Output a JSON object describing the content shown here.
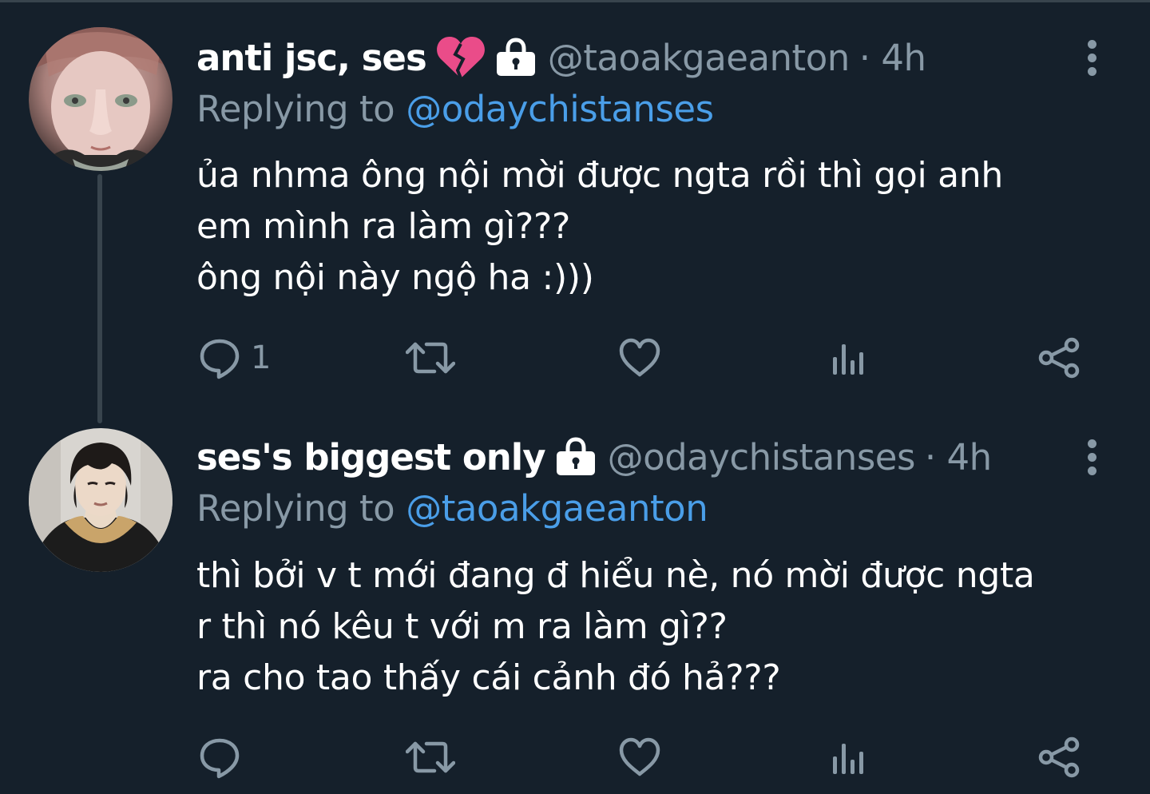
{
  "colors": {
    "background": "#15202b",
    "primary_text": "#ffffff",
    "secondary_text": "#8899a6",
    "link": "#4a9ee8",
    "broken_heart": "#ea4c89"
  },
  "tweets": [
    {
      "display_name": "anti jsc, ses",
      "name_emoji": "broken-heart-icon",
      "protected_icon": "lock-icon",
      "handle": "@taoakgaeanton",
      "time": "· 4h",
      "reply_prefix": "Replying to",
      "reply_to": "@odaychistanses",
      "text_lines": [
        "ủa nhma ông nội mời được ngta rồi thì gọi anh",
        "em mình ra làm gì???",
        "ông nội này ngộ ha :)))"
      ],
      "actions": {
        "reply_count": "1",
        "icons": [
          "reply-icon",
          "retweet-icon",
          "like-icon",
          "analytics-icon",
          "share-icon"
        ]
      }
    },
    {
      "display_name": "ses's biggest only",
      "protected_icon": "lock-icon",
      "handle": "@odaychistanses",
      "time": "· 4h",
      "reply_prefix": "Replying to",
      "reply_to": "@taoakgaeanton",
      "text_lines": [
        "thì bởi v t mới đang đ hiểu nè, nó mời được ngta",
        "r thì nó kêu t với m ra làm gì??",
        "ra cho tao thấy cái cảnh đó hả???"
      ],
      "actions": {
        "reply_count": "",
        "icons": [
          "reply-icon",
          "retweet-icon",
          "like-icon",
          "analytics-icon",
          "share-icon"
        ]
      }
    }
  ]
}
